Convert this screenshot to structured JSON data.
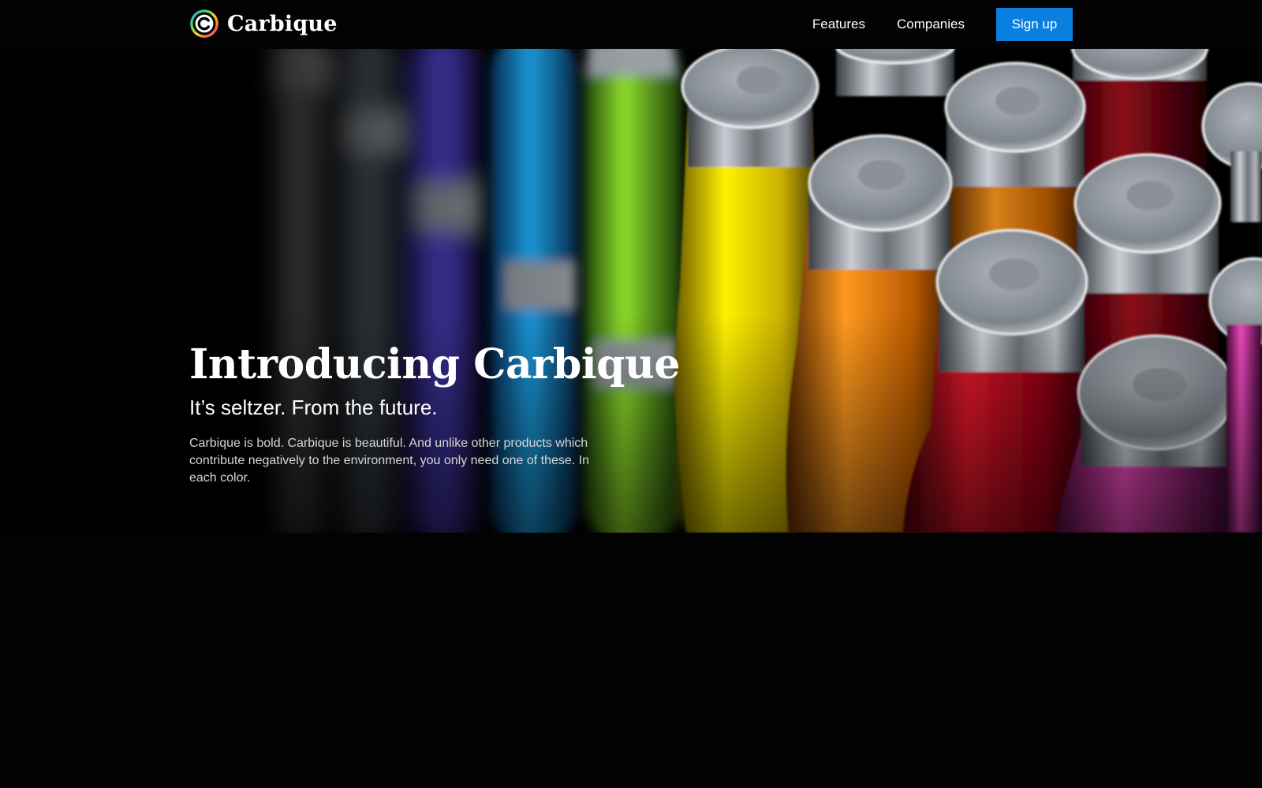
{
  "brand": {
    "name": "Carbique",
    "logo_icon": "rainbow-ring-c-logo"
  },
  "nav": {
    "links": [
      {
        "label": "Features"
      },
      {
        "label": "Companies"
      }
    ],
    "cta_label": "Sign up"
  },
  "hero": {
    "title": "Introducing Carbique",
    "subtitle": "It’s seltzer. From the future.",
    "body": "Carbique is bold. Carbique is beautiful. And unlike other products which contribute negatively to the environment, you only need one of these. In each color."
  },
  "colors": {
    "background": "#020202",
    "accent": "#0a7fe0",
    "text": "#ffffff",
    "muted_text": "#d6d6d6"
  }
}
